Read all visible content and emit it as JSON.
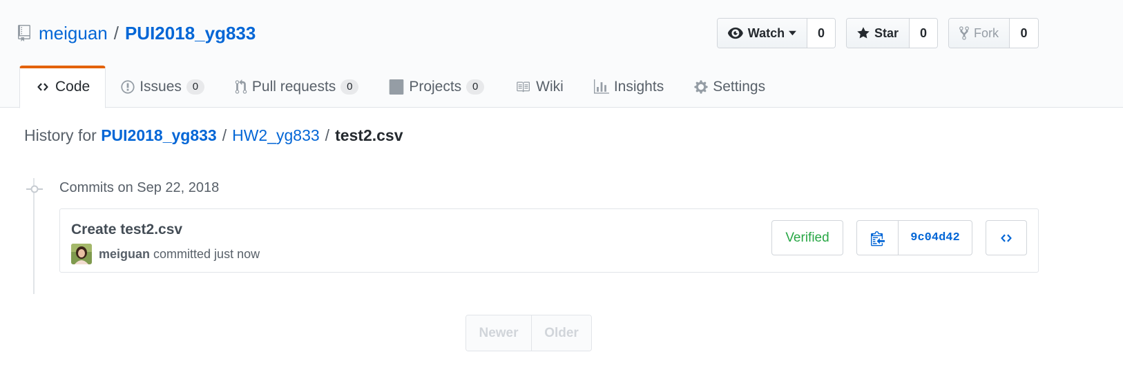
{
  "repo": {
    "owner": "meiguan",
    "separator": "/",
    "name": "PUI2018_yg833"
  },
  "actions": {
    "watch": {
      "label": "Watch",
      "count": "0"
    },
    "star": {
      "label": "Star",
      "count": "0"
    },
    "fork": {
      "label": "Fork",
      "count": "0"
    }
  },
  "tabs": [
    {
      "label": "Code"
    },
    {
      "label": "Issues",
      "counter": "0"
    },
    {
      "label": "Pull requests",
      "counter": "0"
    },
    {
      "label": "Projects",
      "counter": "0"
    },
    {
      "label": "Wiki"
    },
    {
      "label": "Insights"
    },
    {
      "label": "Settings"
    }
  ],
  "history": {
    "prefix": "History for",
    "repo": "PUI2018_yg833",
    "sep": "/",
    "folder": "HW2_yg833",
    "file": "test2.csv"
  },
  "commits_date": "Commits on Sep 22, 2018",
  "commit": {
    "title": "Create test2.csv",
    "author": "meiguan",
    "action": "committed just now",
    "verified": "Verified",
    "sha": "9c04d42"
  },
  "pagination": {
    "newer": "Newer",
    "older": "Older"
  },
  "colors": {
    "link": "#0366d6",
    "selected_tab_accent": "#e36209",
    "verified": "#28a745"
  }
}
